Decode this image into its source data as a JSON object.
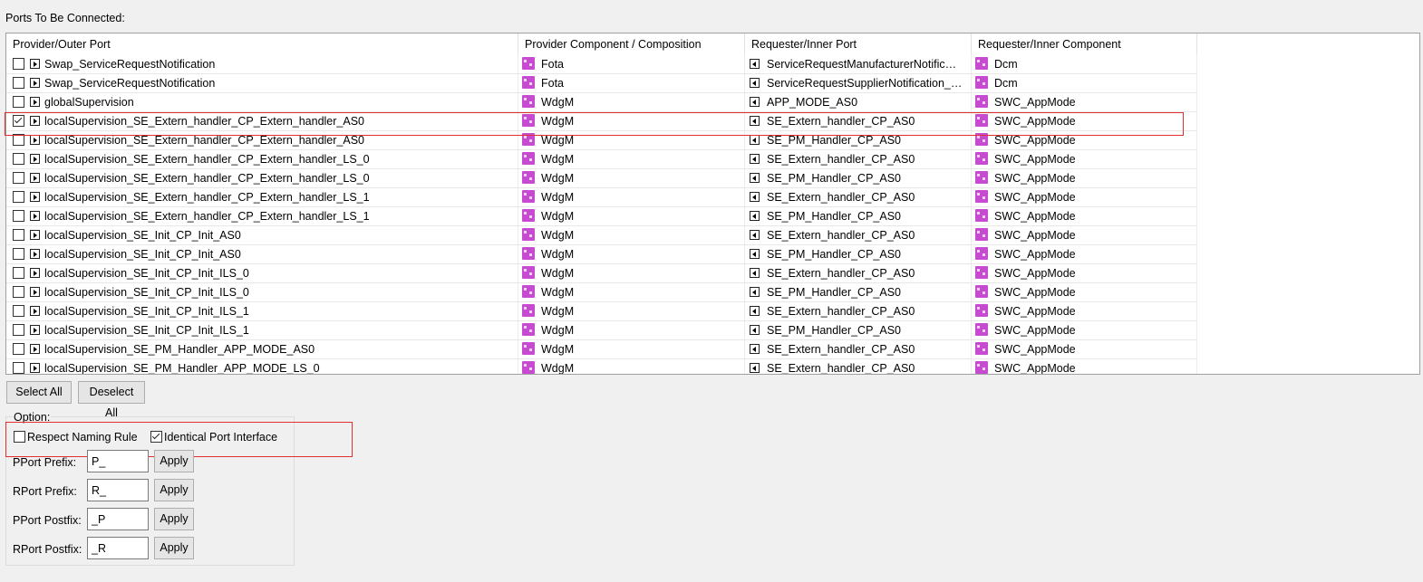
{
  "section_label": "Ports To Be Connected:",
  "columns": [
    "Provider/Outer Port",
    "Provider Component / Composition",
    "Requester/Inner Port",
    "Requester/Inner Component"
  ],
  "rows": [
    {
      "checked": false,
      "provider_port": "Swap_ServiceRequestNotification",
      "provider_component": "Fota",
      "requester_port": "ServiceRequestManufacturerNotific…",
      "requester_component": "Dcm"
    },
    {
      "checked": false,
      "provider_port": "Swap_ServiceRequestNotification",
      "provider_component": "Fota",
      "requester_port": "ServiceRequestSupplierNotification_…",
      "requester_component": "Dcm"
    },
    {
      "checked": false,
      "provider_port": "globalSupervision",
      "provider_component": "WdgM",
      "requester_port": "APP_MODE_AS0",
      "requester_component": "SWC_AppMode"
    },
    {
      "checked": true,
      "provider_port": "localSupervision_SE_Extern_handler_CP_Extern_handler_AS0",
      "provider_component": "WdgM",
      "requester_port": "SE_Extern_handler_CP_AS0",
      "requester_component": "SWC_AppMode"
    },
    {
      "checked": false,
      "provider_port": "localSupervision_SE_Extern_handler_CP_Extern_handler_AS0",
      "provider_component": "WdgM",
      "requester_port": "SE_PM_Handler_CP_AS0",
      "requester_component": "SWC_AppMode"
    },
    {
      "checked": false,
      "provider_port": "localSupervision_SE_Extern_handler_CP_Extern_handler_LS_0",
      "provider_component": "WdgM",
      "requester_port": "SE_Extern_handler_CP_AS0",
      "requester_component": "SWC_AppMode"
    },
    {
      "checked": false,
      "provider_port": "localSupervision_SE_Extern_handler_CP_Extern_handler_LS_0",
      "provider_component": "WdgM",
      "requester_port": "SE_PM_Handler_CP_AS0",
      "requester_component": "SWC_AppMode"
    },
    {
      "checked": false,
      "provider_port": "localSupervision_SE_Extern_handler_CP_Extern_handler_LS_1",
      "provider_component": "WdgM",
      "requester_port": "SE_Extern_handler_CP_AS0",
      "requester_component": "SWC_AppMode"
    },
    {
      "checked": false,
      "provider_port": "localSupervision_SE_Extern_handler_CP_Extern_handler_LS_1",
      "provider_component": "WdgM",
      "requester_port": "SE_PM_Handler_CP_AS0",
      "requester_component": "SWC_AppMode"
    },
    {
      "checked": false,
      "provider_port": "localSupervision_SE_Init_CP_Init_AS0",
      "provider_component": "WdgM",
      "requester_port": "SE_Extern_handler_CP_AS0",
      "requester_component": "SWC_AppMode"
    },
    {
      "checked": false,
      "provider_port": "localSupervision_SE_Init_CP_Init_AS0",
      "provider_component": "WdgM",
      "requester_port": "SE_PM_Handler_CP_AS0",
      "requester_component": "SWC_AppMode"
    },
    {
      "checked": false,
      "provider_port": "localSupervision_SE_Init_CP_Init_ILS_0",
      "provider_component": "WdgM",
      "requester_port": "SE_Extern_handler_CP_AS0",
      "requester_component": "SWC_AppMode"
    },
    {
      "checked": false,
      "provider_port": "localSupervision_SE_Init_CP_Init_ILS_0",
      "provider_component": "WdgM",
      "requester_port": "SE_PM_Handler_CP_AS0",
      "requester_component": "SWC_AppMode"
    },
    {
      "checked": false,
      "provider_port": "localSupervision_SE_Init_CP_Init_ILS_1",
      "provider_component": "WdgM",
      "requester_port": "SE_Extern_handler_CP_AS0",
      "requester_component": "SWC_AppMode"
    },
    {
      "checked": false,
      "provider_port": "localSupervision_SE_Init_CP_Init_ILS_1",
      "provider_component": "WdgM",
      "requester_port": "SE_PM_Handler_CP_AS0",
      "requester_component": "SWC_AppMode"
    },
    {
      "checked": false,
      "provider_port": "localSupervision_SE_PM_Handler_APP_MODE_AS0",
      "provider_component": "WdgM",
      "requester_port": "SE_Extern_handler_CP_AS0",
      "requester_component": "SWC_AppMode"
    },
    {
      "checked": false,
      "provider_port": "localSupervision_SE_PM_Handler_APP_MODE_LS_0",
      "provider_component": "WdgM",
      "requester_port": "SE_Extern_handler_CP_AS0",
      "requester_component": "SWC_AppMode"
    }
  ],
  "buttons": {
    "select_all": "Select All",
    "deselect_all": "Deselect All"
  },
  "option": {
    "title": "Option:",
    "respect_naming_rule": {
      "label": "Respect Naming Rule",
      "checked": false
    },
    "identical_port_interface": {
      "label": "Identical Port Interface",
      "checked": true
    },
    "fields": [
      {
        "label": "PPort Prefix:",
        "value": "P_",
        "apply": "Apply"
      },
      {
        "label": "RPort Prefix:",
        "value": "R_",
        "apply": "Apply"
      },
      {
        "label": "PPort Postfix:",
        "value": "_P",
        "apply": "Apply"
      },
      {
        "label": "RPort Postfix:",
        "value": "_R",
        "apply": "Apply"
      }
    ]
  },
  "colors": {
    "highlight": "#e03030",
    "component_icon": "#c64bd1"
  },
  "icons": {
    "provider_port": "provider-port-icon",
    "requester_port": "requester-port-icon",
    "component": "component-icon"
  }
}
